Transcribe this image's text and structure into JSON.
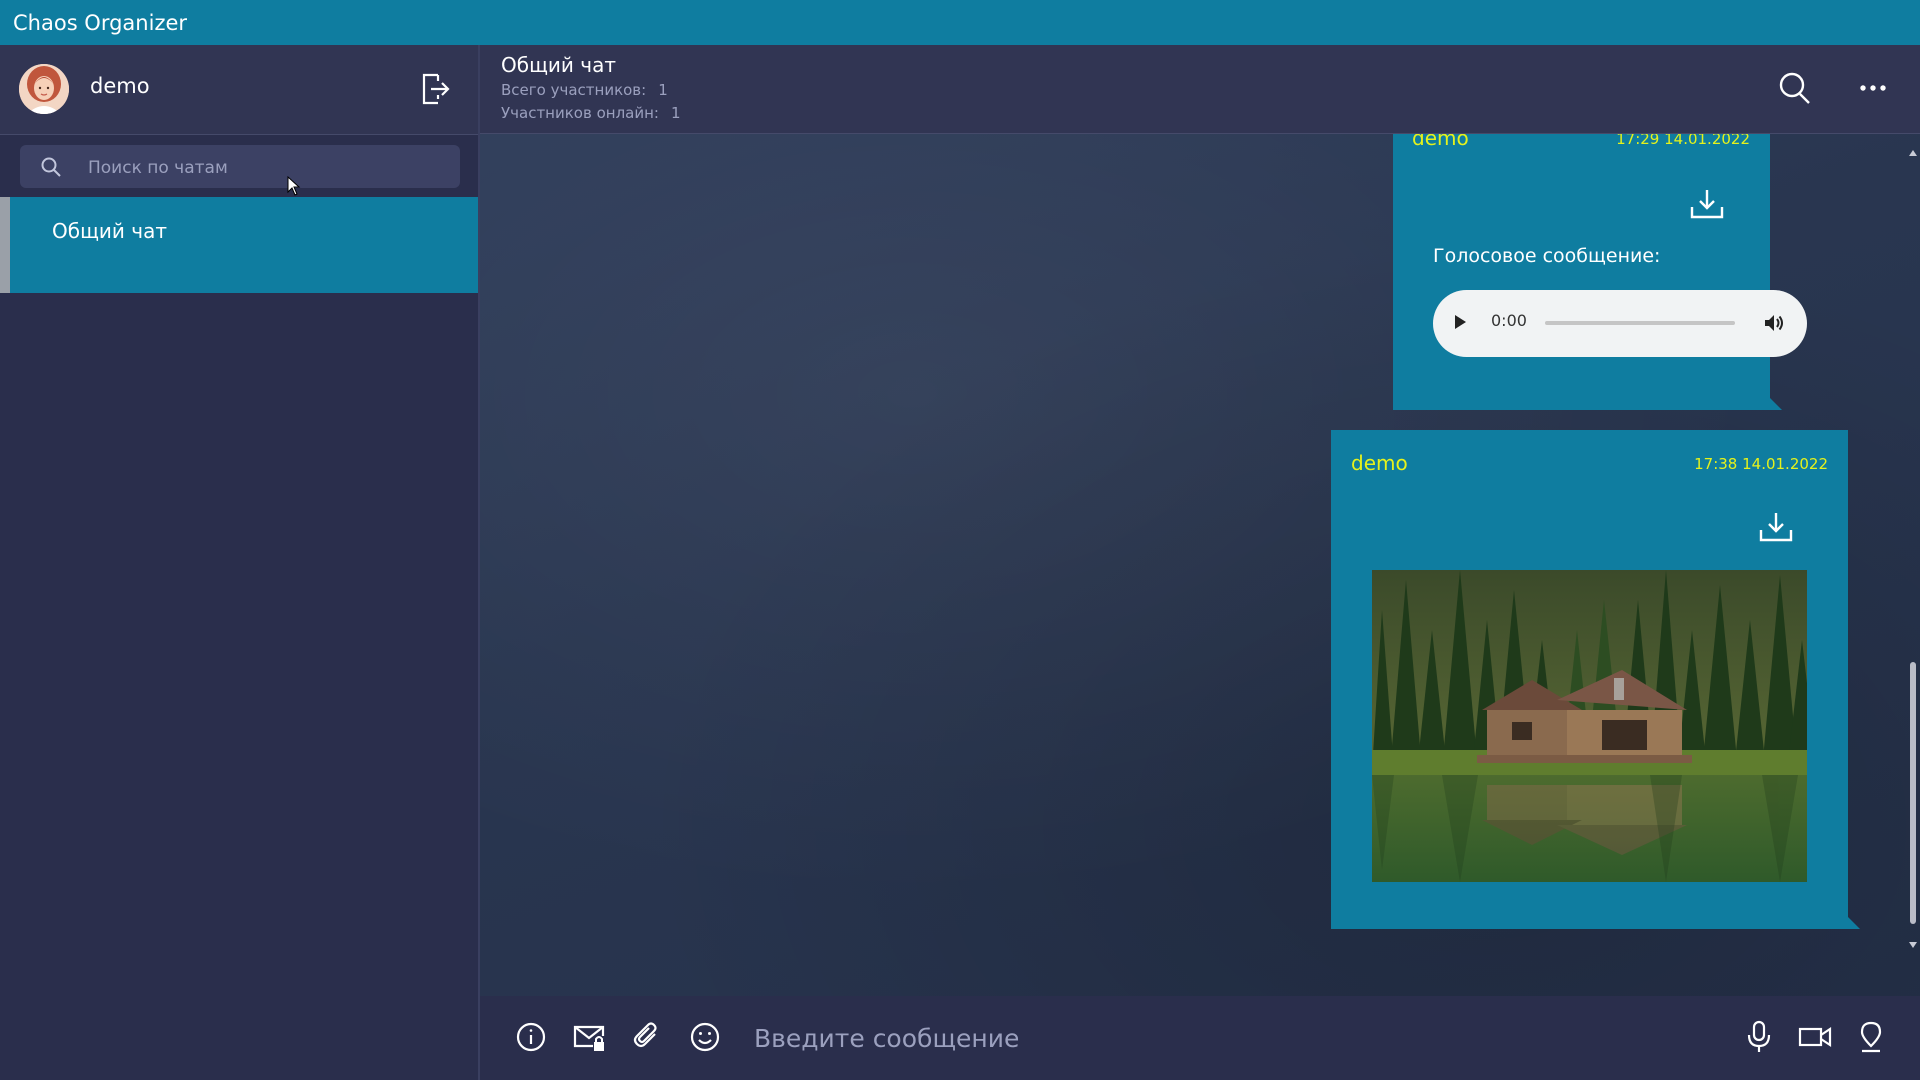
{
  "app": {
    "title": "Chaos Organizer"
  },
  "user": {
    "name": "demo"
  },
  "search": {
    "placeholder": "Поиск по чатам"
  },
  "chats": [
    {
      "label": "Общий чат",
      "active": true
    }
  ],
  "chat": {
    "title": "Общий чат",
    "total_label": "Всего участников:",
    "total_value": "1",
    "online_label": "Участников онлайн:",
    "online_value": "1"
  },
  "messages": [
    {
      "author": "demo",
      "time": "17:29 14.01.2022",
      "type": "voice",
      "label": "Голосовое сообщение:",
      "audio": {
        "current_time": "0:00",
        "progress": 0
      }
    },
    {
      "author": "demo",
      "time": "17:38 14.01.2022",
      "type": "image"
    }
  ],
  "composer": {
    "placeholder": "Введите сообщение"
  },
  "colors": {
    "accent": "#0f7da0",
    "sidebar_bg": "#2a2e4c",
    "header_bg": "#313553",
    "author_color": "#e5f21c"
  },
  "icons": {
    "logout": "logout-icon",
    "search": "search-icon",
    "more": "more-icon",
    "download": "download-icon",
    "info": "info-icon",
    "mail": "mail-lock-icon",
    "attach": "paperclip-icon",
    "emoji": "emoji-icon",
    "mic": "microphone-icon",
    "video": "video-camera-icon",
    "location": "location-pin-icon"
  }
}
